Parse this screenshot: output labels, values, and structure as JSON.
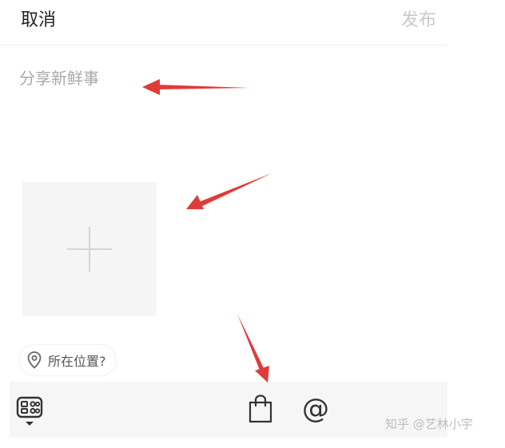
{
  "header": {
    "cancel_label": "取消",
    "publish_label": "发布"
  },
  "compose": {
    "placeholder": "分享新鲜事"
  },
  "location": {
    "label": "所在位置?"
  },
  "toolbar": {
    "at_symbol": "@",
    "icons": [
      "apps-grid-icon",
      "shopping-bag-icon",
      "at-icon"
    ]
  },
  "watermark": {
    "text": "知乎 @艺林小宇"
  },
  "colors": {
    "arrow": "#e03a3a",
    "publish_disabled": "#c9c9c9",
    "toolbar_bg": "#f6f6f6",
    "tile_bg": "#f5f5f5"
  }
}
